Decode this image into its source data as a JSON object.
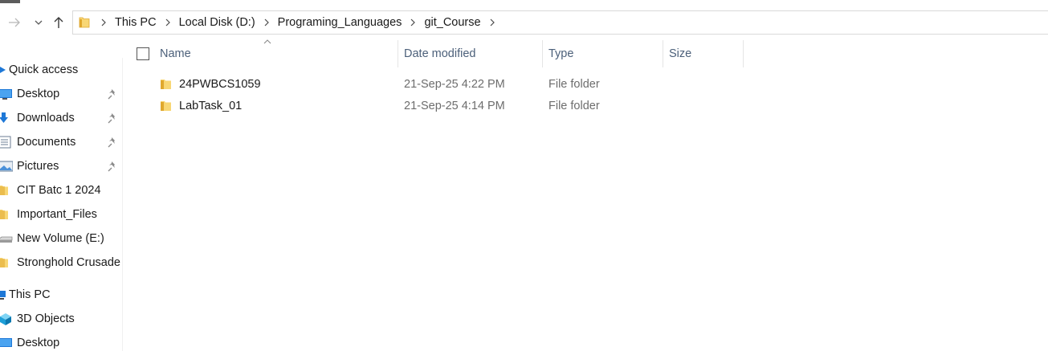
{
  "address_bar": {
    "breadcrumbs": [
      "This PC",
      "Local Disk (D:)",
      "Programing_Languages",
      "git_Course"
    ]
  },
  "sidebar": {
    "quick_access_label": "Quick access",
    "items": [
      {
        "label": "Desktop",
        "icon": "desktop-icon",
        "pinned": true
      },
      {
        "label": "Downloads",
        "icon": "downloads-icon",
        "pinned": true
      },
      {
        "label": "Documents",
        "icon": "documents-icon",
        "pinned": true
      },
      {
        "label": "Pictures",
        "icon": "pictures-icon",
        "pinned": true
      },
      {
        "label": "CIT Batc 1 2024",
        "icon": "folder-icon",
        "pinned": false
      },
      {
        "label": "Important_Files",
        "icon": "folder-icon",
        "pinned": false
      },
      {
        "label": "New Volume (E:)",
        "icon": "drive-icon",
        "pinned": false
      },
      {
        "label": "Stronghold Crusade",
        "icon": "folder-icon",
        "pinned": false
      }
    ],
    "this_pc_label": "This PC",
    "this_pc_items": [
      {
        "label": "3D Objects",
        "icon": "3d-objects-icon"
      },
      {
        "label": "Desktop",
        "icon": "desktop-icon"
      }
    ]
  },
  "columns": {
    "name": "Name",
    "date_modified": "Date modified",
    "type": "Type",
    "size": "Size"
  },
  "files": [
    {
      "name": "24PWBCS1059",
      "date_modified": "21-Sep-25 4:22 PM",
      "type": "File folder",
      "size": ""
    },
    {
      "name": "LabTask_01",
      "date_modified": "21-Sep-25 4:14 PM",
      "type": "File folder",
      "size": ""
    }
  ],
  "colors": {
    "folder_yellow": "#f8d775",
    "folder_dark": "#e0a82e",
    "header_text": "#4c607a",
    "meta_text": "#6d6d6d",
    "accent_blue": "#1e78d7"
  }
}
